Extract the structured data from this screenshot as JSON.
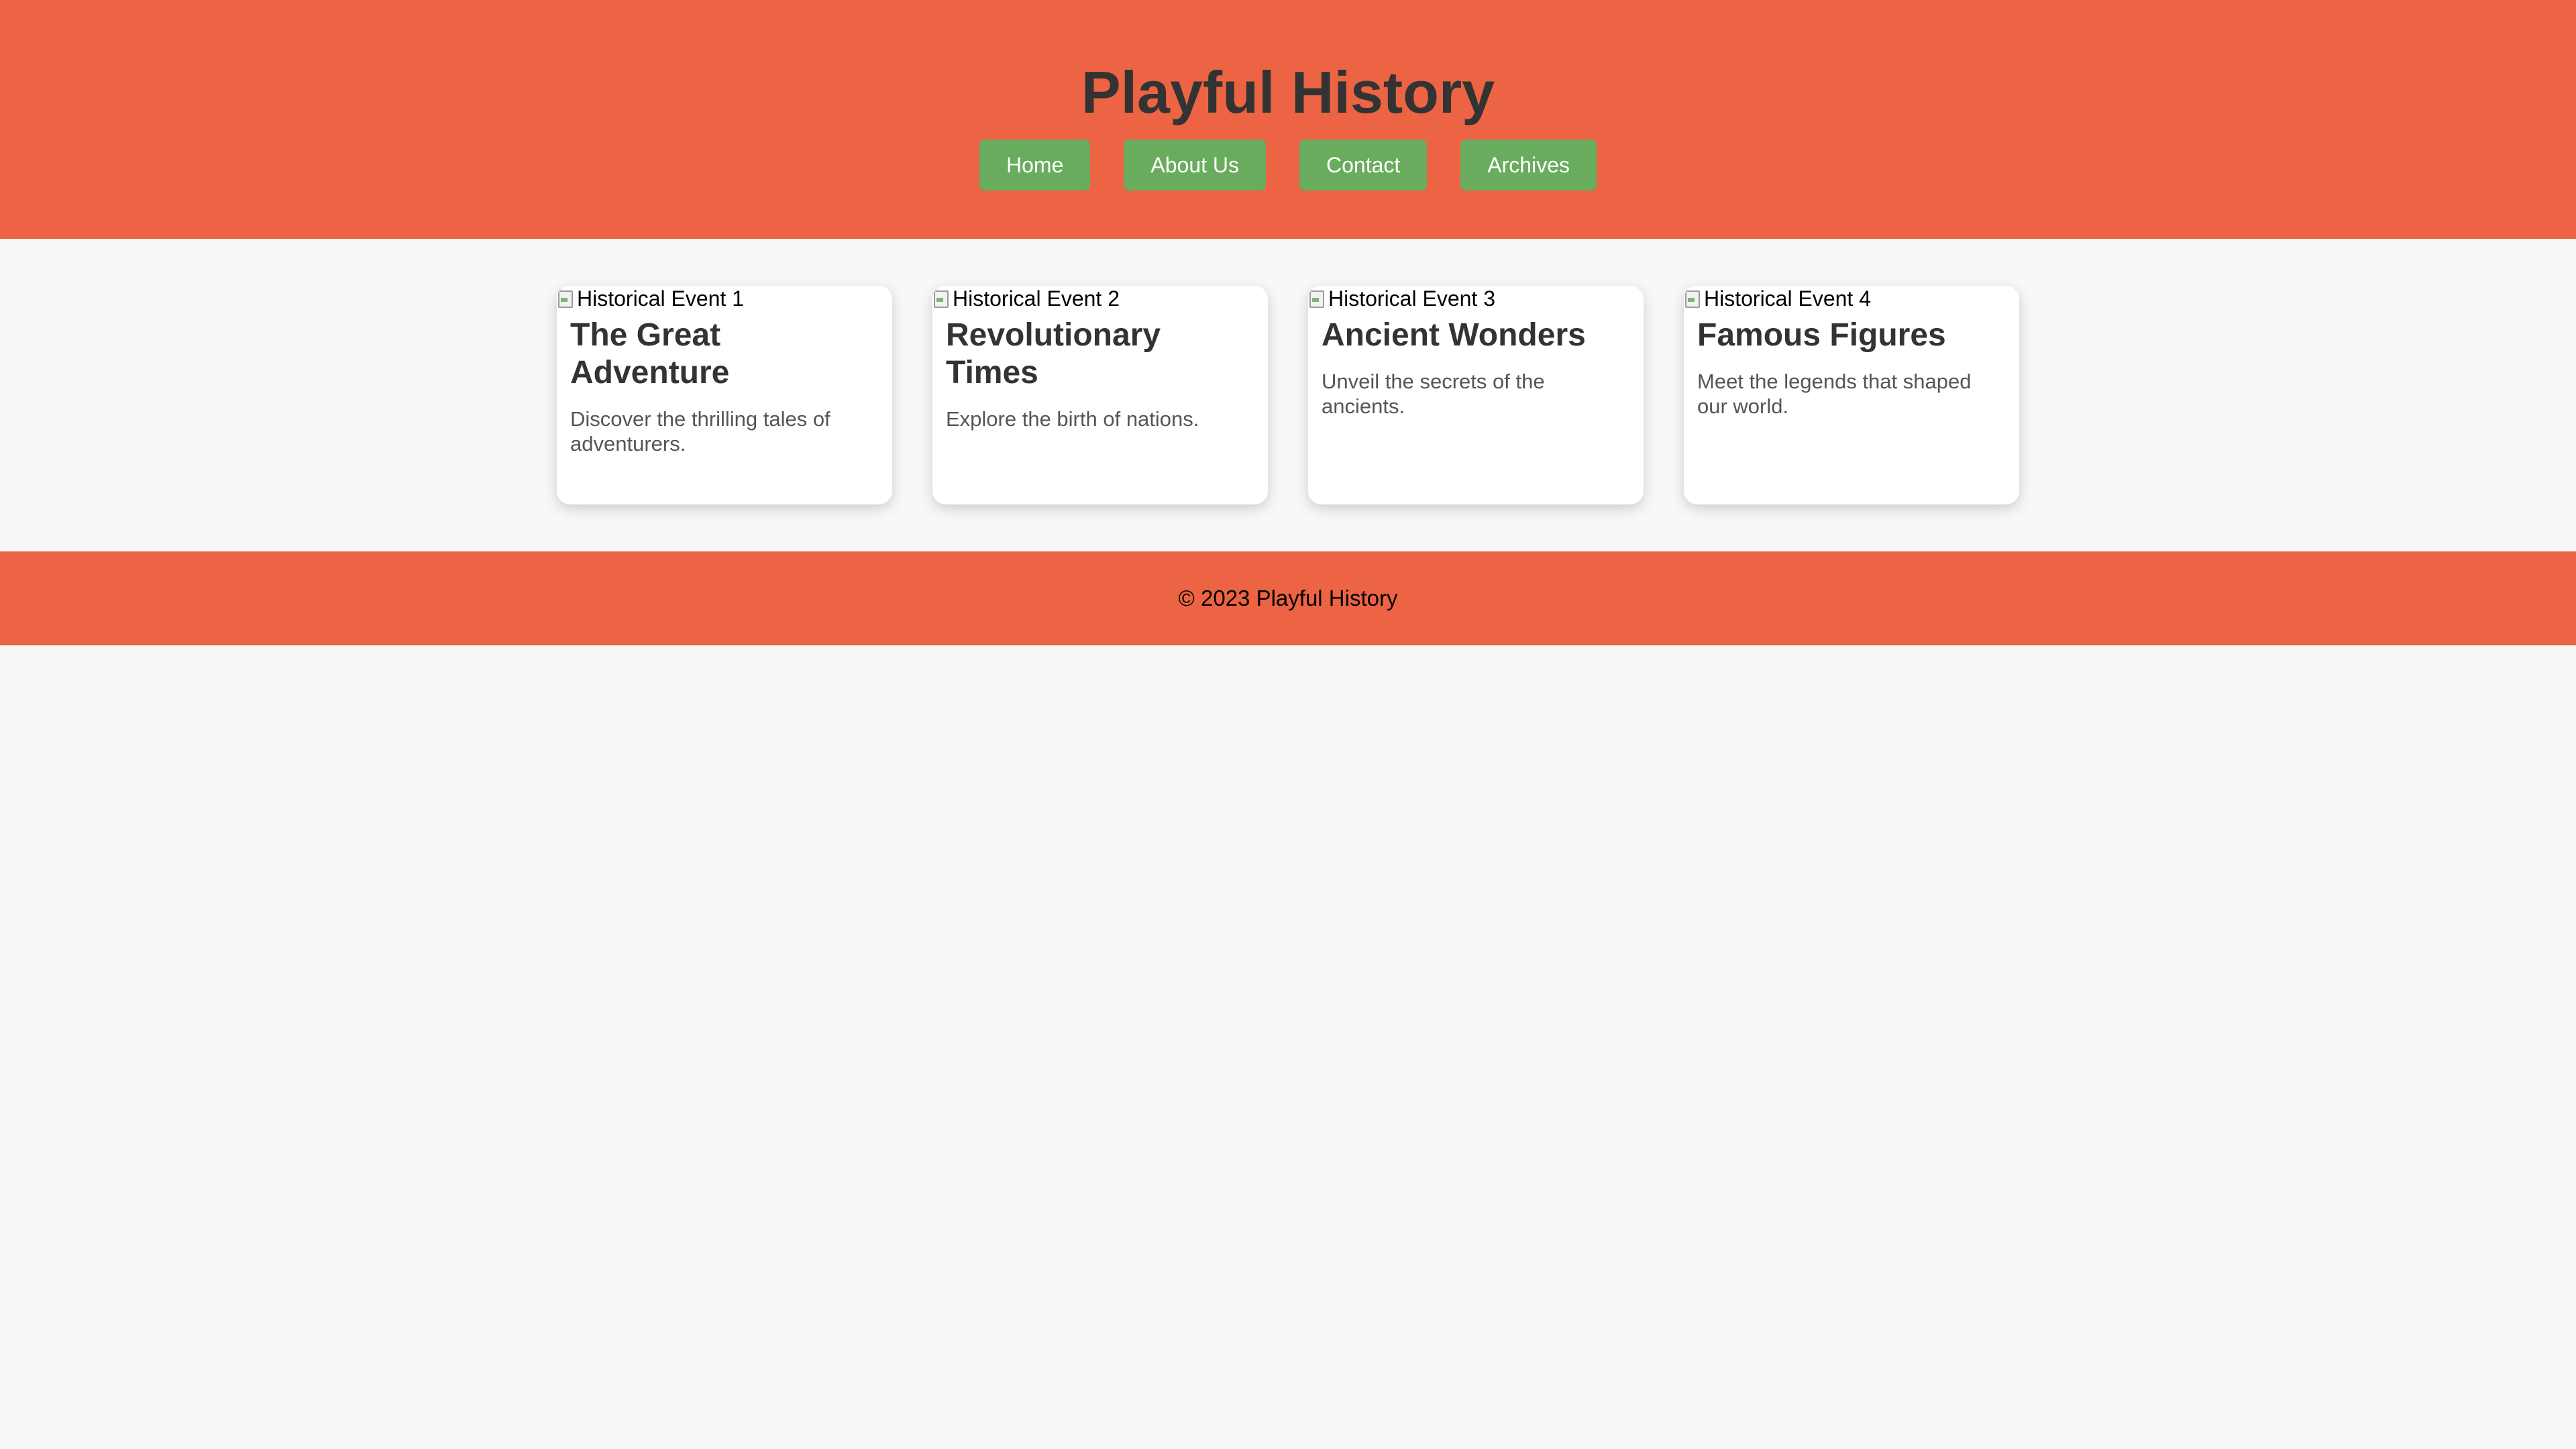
{
  "header": {
    "title": "Playful History",
    "nav": [
      {
        "label": "Home"
      },
      {
        "label": "About Us"
      },
      {
        "label": "Contact"
      },
      {
        "label": "Archives"
      }
    ]
  },
  "cards": [
    {
      "image_alt": "Historical Event 1",
      "title": "The Great Adventure",
      "description": "Discover the thrilling tales of adventurers."
    },
    {
      "image_alt": "Historical Event 2",
      "title": "Revolutionary Times",
      "description": "Explore the birth of nations."
    },
    {
      "image_alt": "Historical Event 3",
      "title": "Ancient Wonders",
      "description": "Unveil the secrets of the ancients."
    },
    {
      "image_alt": "Historical Event 4",
      "title": "Famous Figures",
      "description": "Meet the legends that shaped our world."
    }
  ],
  "footer": {
    "text": "© 2023 Playful History"
  },
  "colors": {
    "header_background": "#ec6443",
    "nav_button": "#6aac5e",
    "page_background": "#f8f8f8"
  },
  "icons": {
    "card_image": "broken-image-icon"
  }
}
